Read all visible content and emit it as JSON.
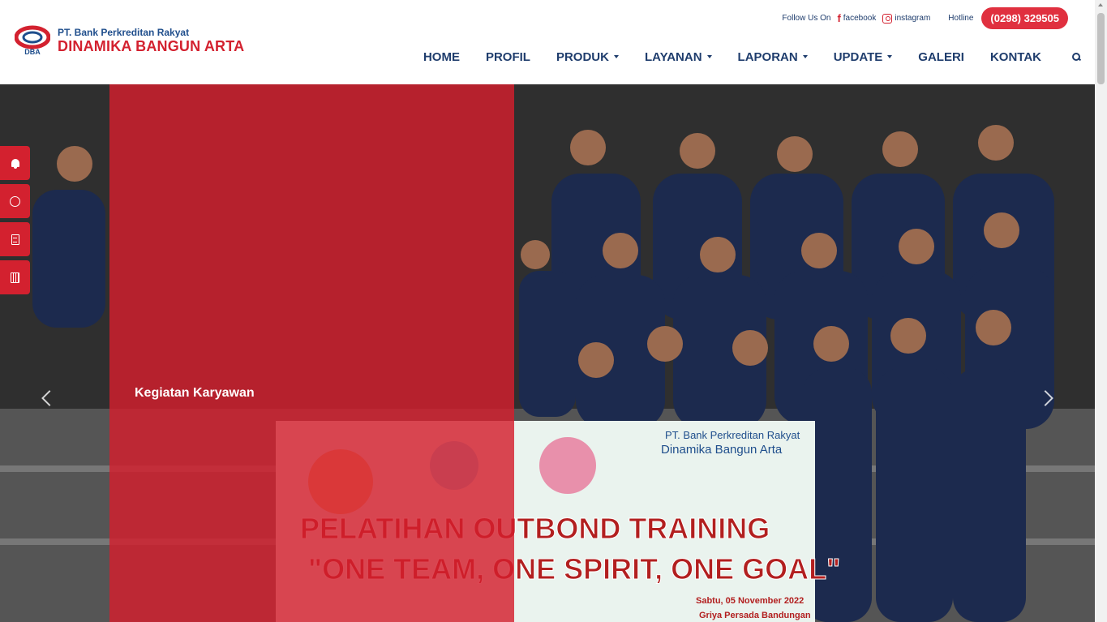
{
  "header": {
    "logo": {
      "abbr": "DBA",
      "small": "PT. Bank Perkreditan Rakyat",
      "big": "DINAMIKA BANGUN ARTA"
    },
    "follow_label": "Follow Us On",
    "social": [
      {
        "icon": "facebook-icon",
        "label": "facebook"
      },
      {
        "icon": "instagram-icon",
        "label": "instagram"
      }
    ],
    "hotline_label": "Hotline",
    "hotline_number": "(0298) 329505"
  },
  "nav": {
    "items": [
      {
        "label": "HOME",
        "dropdown": false
      },
      {
        "label": "PROFIL",
        "dropdown": false
      },
      {
        "label": "PRODUK",
        "dropdown": true
      },
      {
        "label": "LAYANAN",
        "dropdown": true
      },
      {
        "label": "LAPORAN",
        "dropdown": true
      },
      {
        "label": "UPDATE",
        "dropdown": true
      },
      {
        "label": "GALERI",
        "dropdown": false
      },
      {
        "label": "KONTAK",
        "dropdown": false
      }
    ]
  },
  "hero": {
    "caption": "Kegiatan Karyawan",
    "banner": {
      "org_small": "PT. Bank Perkreditan Rakyat",
      "org_big": "Dinamika Bangun Arta",
      "title_line1": "PELATIHAN OUTBOND TRAINING",
      "title_line2": "\"ONE TEAM, ONE SPIRIT, ONE GOAL\"",
      "date": "Sabtu, 05 November 2022",
      "place": "Griya Persada Bandungan"
    }
  },
  "floating_buttons": [
    "bell-icon",
    "whatsapp-icon",
    "document-icon",
    "calculator-icon"
  ],
  "colors": {
    "brand_red": "#d3212f",
    "brand_blue": "#1f3d6d"
  }
}
